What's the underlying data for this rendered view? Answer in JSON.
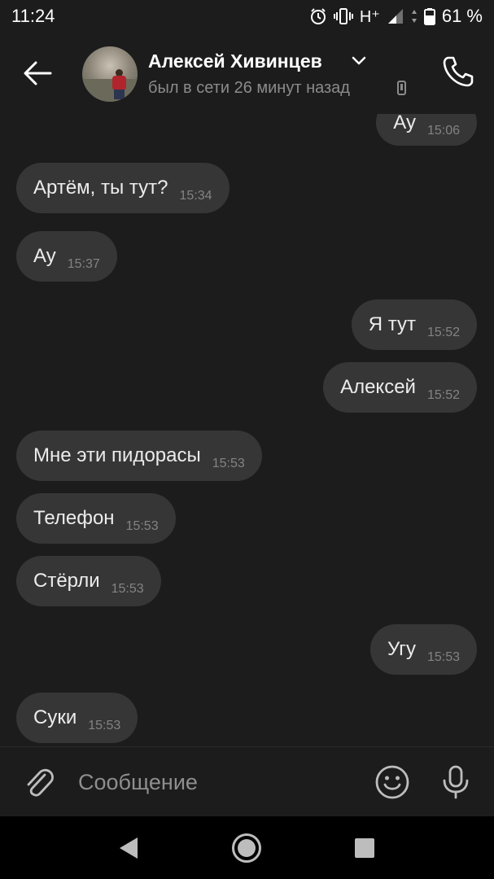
{
  "status_bar": {
    "time": "11:24",
    "network": "H⁺",
    "battery": "61 %"
  },
  "header": {
    "contact_name": "Алексей Хивинцев",
    "last_seen": "был в сети 26 минут назад"
  },
  "messages": [
    {
      "text": "Ау",
      "time": "15:06",
      "side": "out"
    },
    {
      "text": "Артём, ты тут?",
      "time": "15:34",
      "side": "in"
    },
    {
      "text": "Ау",
      "time": "15:37",
      "side": "in"
    },
    {
      "text": "Я тут",
      "time": "15:52",
      "side": "out"
    },
    {
      "text": "Алексей",
      "time": "15:52",
      "side": "out"
    },
    {
      "text": "Мне эти пидорасы",
      "time": "15:53",
      "side": "in"
    },
    {
      "text": "Телефон",
      "time": "15:53",
      "side": "in"
    },
    {
      "text": "Стёрли",
      "time": "15:53",
      "side": "in"
    },
    {
      "text": "Угу",
      "time": "15:53",
      "side": "out"
    },
    {
      "text": "Суки",
      "time": "15:53",
      "side": "in"
    }
  ],
  "composer": {
    "placeholder": "Сообщение",
    "value": ""
  },
  "icons": {
    "back": "arrow-left-icon",
    "call": "phone-icon",
    "attach": "paperclip-icon",
    "emoji": "smiley-icon",
    "mic": "microphone-icon"
  },
  "colors": {
    "background": "#1c1c1c",
    "bubble": "#363636",
    "text": "#ececec",
    "timestamp": "#838383",
    "secondary": "#8b8b8b"
  }
}
